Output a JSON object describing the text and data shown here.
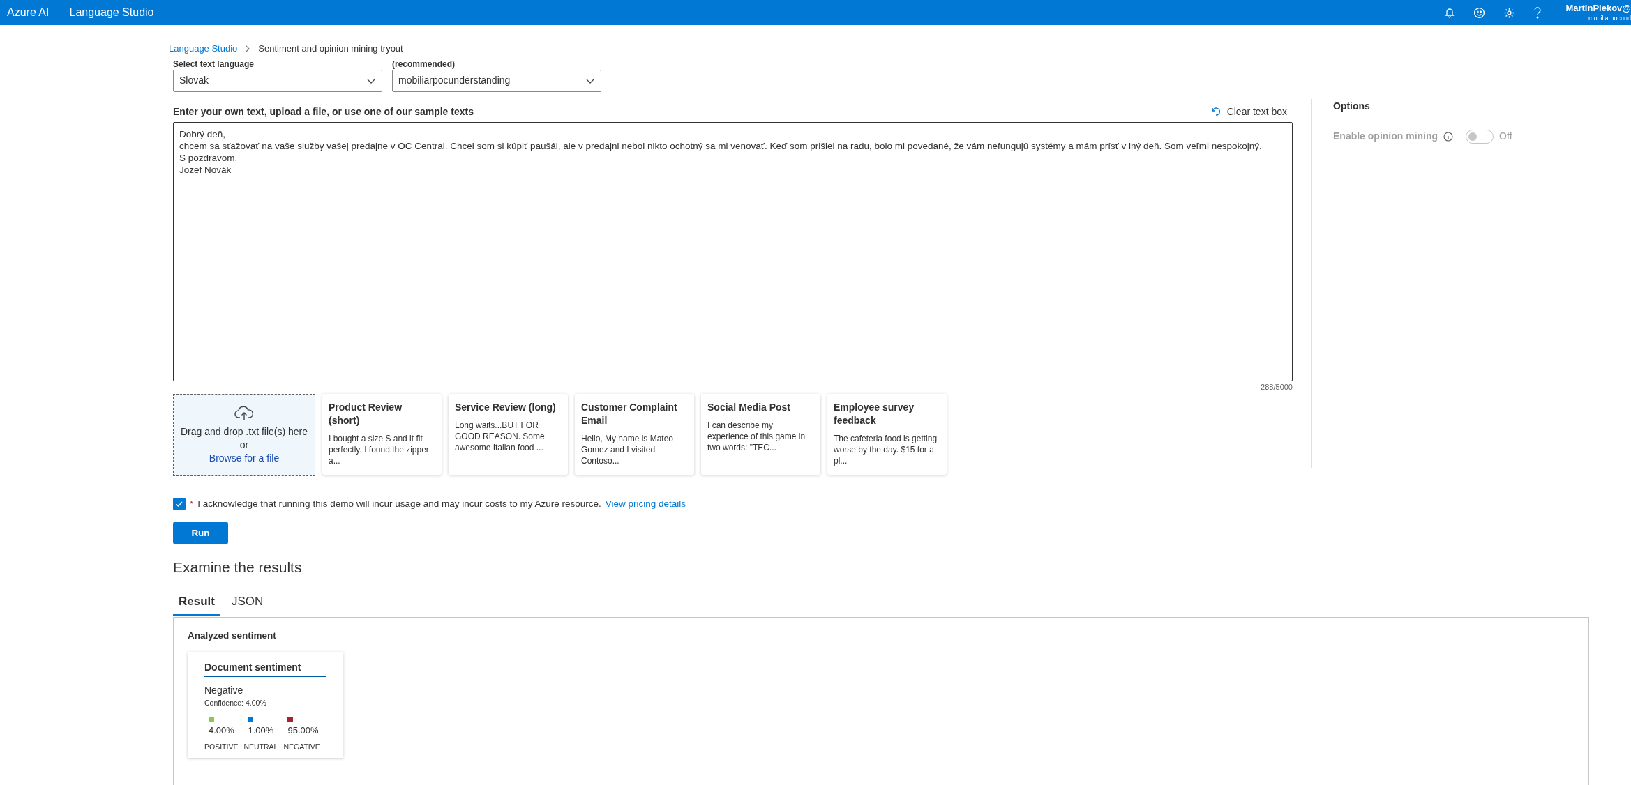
{
  "header": {
    "brand": "Azure AI",
    "product": "Language Studio",
    "user_name": "MartinPiekov@",
    "user_org": "mobiliarpocund"
  },
  "breadcrumb": [
    {
      "label": "Language Studio",
      "kind": "link"
    },
    {
      "label": "Sentiment and opinion mining tryout",
      "kind": "current"
    }
  ],
  "selects": [
    {
      "label": "Select text language",
      "value": "Slovak"
    },
    {
      "label": "(recommended)",
      "value": "mobiliarpocunderstanding"
    }
  ],
  "input": {
    "label": "Enter your own text, upload a file, or use one of our sample texts",
    "clear": "Clear text box",
    "value": "Dobrý deň,\nchcem sa sťažovať na vaše služby vašej predajne v OC Central. Chcel som si kúpiť paušál, ale v predajni nebol nikto ochotný sa mi venovať. Keď som prišiel na radu, bolo mi povedané, že vám nefungujú systémy a mám prísť v iný deň. Som veľmi nespokojný.\nS pozdravom,\nJozef Novák",
    "counter": "288/5000"
  },
  "upload": {
    "text": "Drag and drop .txt file(s) here",
    "or": "or",
    "link": "Browse for a file"
  },
  "samples": [
    {
      "title": "Product Review (short)",
      "text": "I bought a size S and it fit perfectly. I found the zipper a..."
    },
    {
      "title": "Service Review (long)",
      "text": "Long waits...BUT FOR GOOD REASON. Some awesome Italian food ..."
    },
    {
      "title": "Customer Complaint Email",
      "text": "Hello, My name is Mateo Gomez and I visited Contoso..."
    },
    {
      "title": "Social Media Post",
      "text": "I can describe my experience of this game in two words: \"TEC..."
    },
    {
      "title": "Employee survey feedback",
      "text": "The cafeteria food is getting worse by the day. $15 for a pl..."
    }
  ],
  "options": {
    "title": "Options",
    "toggle_label": "Enable opinion mining",
    "on": false,
    "state_text": "Off"
  },
  "acknowledge": {
    "checked": true,
    "required": "*",
    "text": "I acknowledge that running this demo will incur usage and may incur costs to my Azure resource.",
    "link": "View pricing details"
  },
  "run_button": "Run",
  "results": {
    "title": "Examine the results",
    "tabs": [
      {
        "label": "Result",
        "selected": true
      },
      {
        "label": "JSON",
        "selected": false
      }
    ],
    "section": "Analyzed sentiment",
    "card": {
      "title": "Document sentiment",
      "sentiment": "Negative",
      "confidence": "Confidence: 4.00%",
      "scores": [
        {
          "value": "4.00%",
          "label": "POSITIVE",
          "color": "#92c353"
        },
        {
          "value": "1.00%",
          "label": "NEUTRAL",
          "color": "#0078d4"
        },
        {
          "value": "95.00%",
          "label": "NEGATIVE",
          "color": "#a4262c"
        }
      ]
    }
  }
}
